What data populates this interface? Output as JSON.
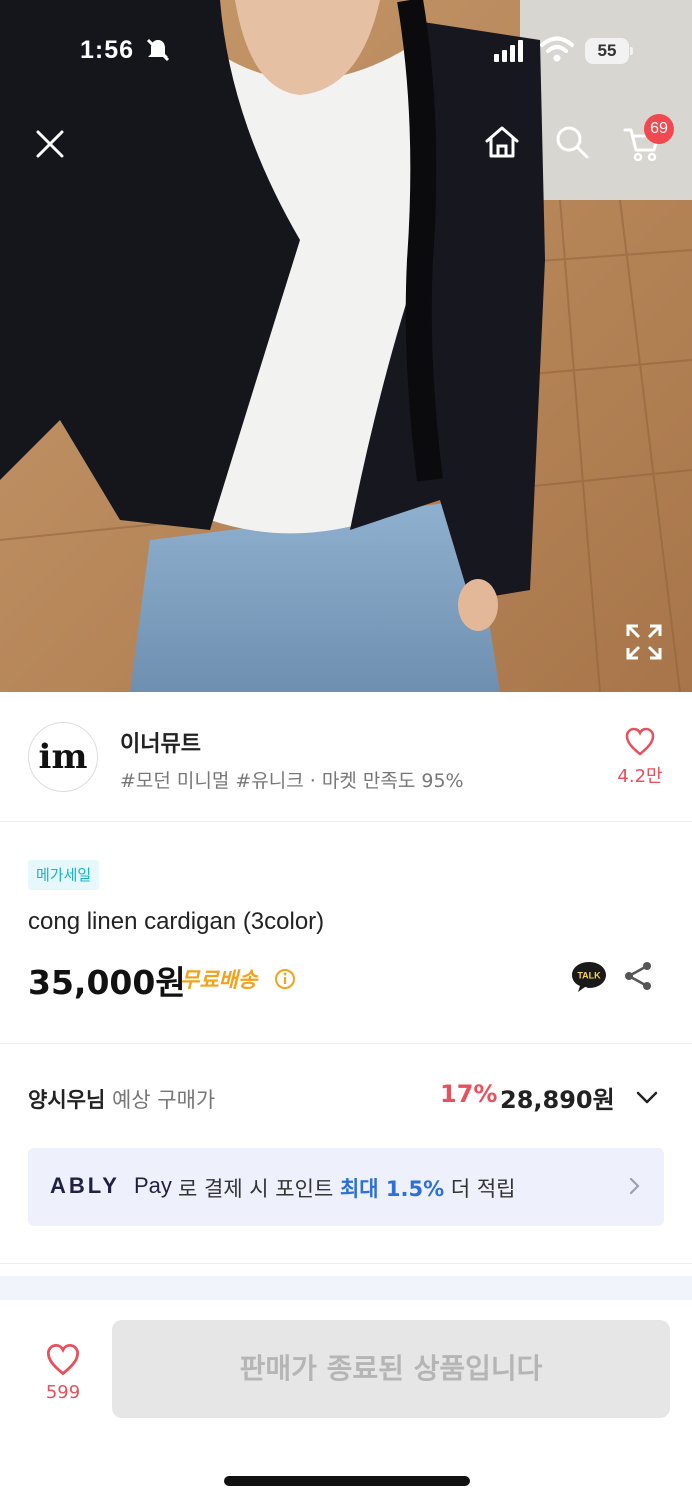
{
  "status_bar": {
    "time": "1:56",
    "battery": "55"
  },
  "top_nav": {
    "cart_count": "69"
  },
  "store": {
    "logo_text": "im",
    "name": "이너뮤트",
    "tags": "#모던 미니멀 #유니크 · 마켓 만족도 95%",
    "like_count": "4.2만"
  },
  "product": {
    "badge": "메가세일",
    "name": "cong linen cardigan (3color)",
    "price": "35,000원",
    "shipping": "무료배송",
    "talk_label": "TALK"
  },
  "expected_price": {
    "user": "양시우님",
    "label": "예상 구매가",
    "discount_rate": "17%",
    "discounted_price": "28,890원"
  },
  "pay_banner": {
    "brand": "ABLY",
    "pay": "Pay",
    "text_before": "로 결제 시 포인트",
    "highlight": "최대 1.5%",
    "text_after": "더 적립"
  },
  "bottom_bar": {
    "wish_count": "599",
    "soldout_label": "판매가 종료된 상품입니다"
  },
  "colors": {
    "accent_red": "#e8505b",
    "badge_teal": "#17b4c9",
    "shipping_orange": "#f2a21b",
    "pay_blue": "#2c6fd6"
  }
}
